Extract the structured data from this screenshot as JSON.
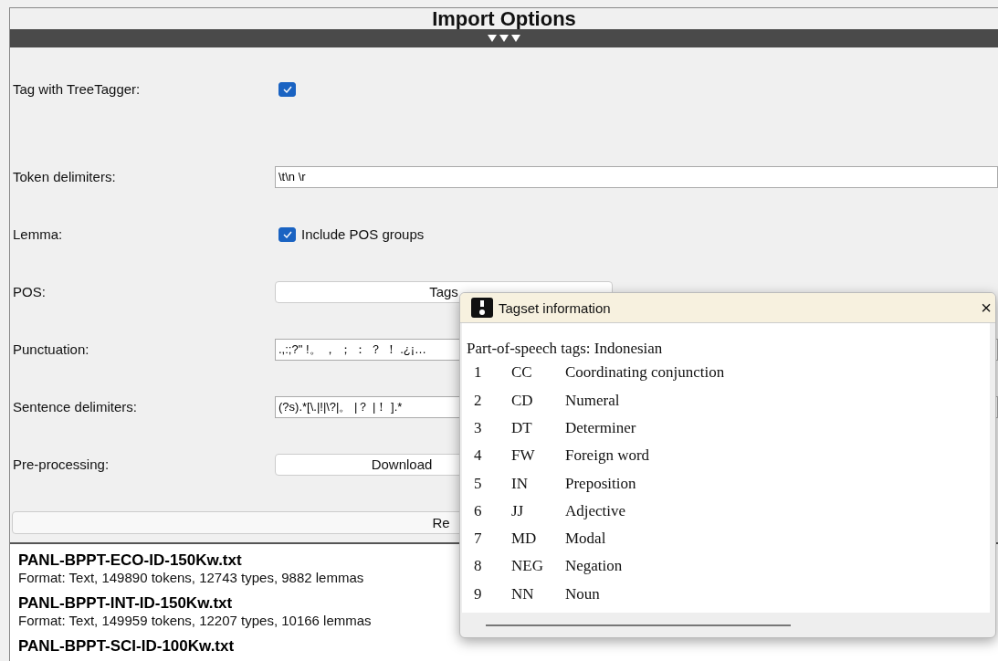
{
  "header": {
    "title": "Import Options"
  },
  "options": [
    {
      "kind": "checkbox",
      "label": "Tag with TreeTagger:",
      "checked": true
    },
    {
      "kind": "field",
      "label": "Token delimiters:",
      "value": "\\t\\n \\r"
    },
    {
      "kind": "checkbox",
      "label": "Lemma:",
      "checked": true,
      "text": "Include POS groups"
    },
    {
      "kind": "button",
      "label": "POS:",
      "button": "Tags"
    },
    {
      "kind": "field",
      "label": "Punctuation:",
      "value": ".,:;?\" !。 ， ； ： ？ ！ .¿¡…"
    },
    {
      "kind": "field",
      "label": "Sentence delimiters:",
      "value": "(?s).*[\\.|!|\\?|。 |？ |！ ].*"
    },
    {
      "kind": "button",
      "label": "Pre-processing:",
      "button": "Download"
    }
  ],
  "recompute_button": "Re",
  "files": [
    {
      "name": "PANL-BPPT-ECO-ID-150Kw.txt",
      "info": "Format: Text, 149890 tokens, 12743 types, 9882 lemmas"
    },
    {
      "name": "PANL-BPPT-INT-ID-150Kw.txt",
      "info": "Format: Text, 149959 tokens, 12207 types, 10166 lemmas"
    },
    {
      "name": "PANL-BPPT-SCI-ID-100Kw.txt"
    }
  ],
  "dialog": {
    "title": "Tagset information",
    "close": "×",
    "heading": "Part-of-speech tags: Indonesian",
    "tags": [
      {
        "number": "1",
        "code": "CC",
        "description": "Coordinating conjunction"
      },
      {
        "number": "2",
        "code": "CD",
        "description": "Numeral"
      },
      {
        "number": "3",
        "code": "DT",
        "description": "Determiner"
      },
      {
        "number": "4",
        "code": "FW",
        "description": "Foreign word"
      },
      {
        "number": "5",
        "code": "IN",
        "description": "Preposition"
      },
      {
        "number": "6",
        "code": "JJ",
        "description": "Adjective"
      },
      {
        "number": "7",
        "code": "MD",
        "description": "Modal"
      },
      {
        "number": "8",
        "code": "NEG",
        "description": "Negation"
      },
      {
        "number": "9",
        "code": "NN",
        "description": "Noun"
      }
    ]
  }
}
